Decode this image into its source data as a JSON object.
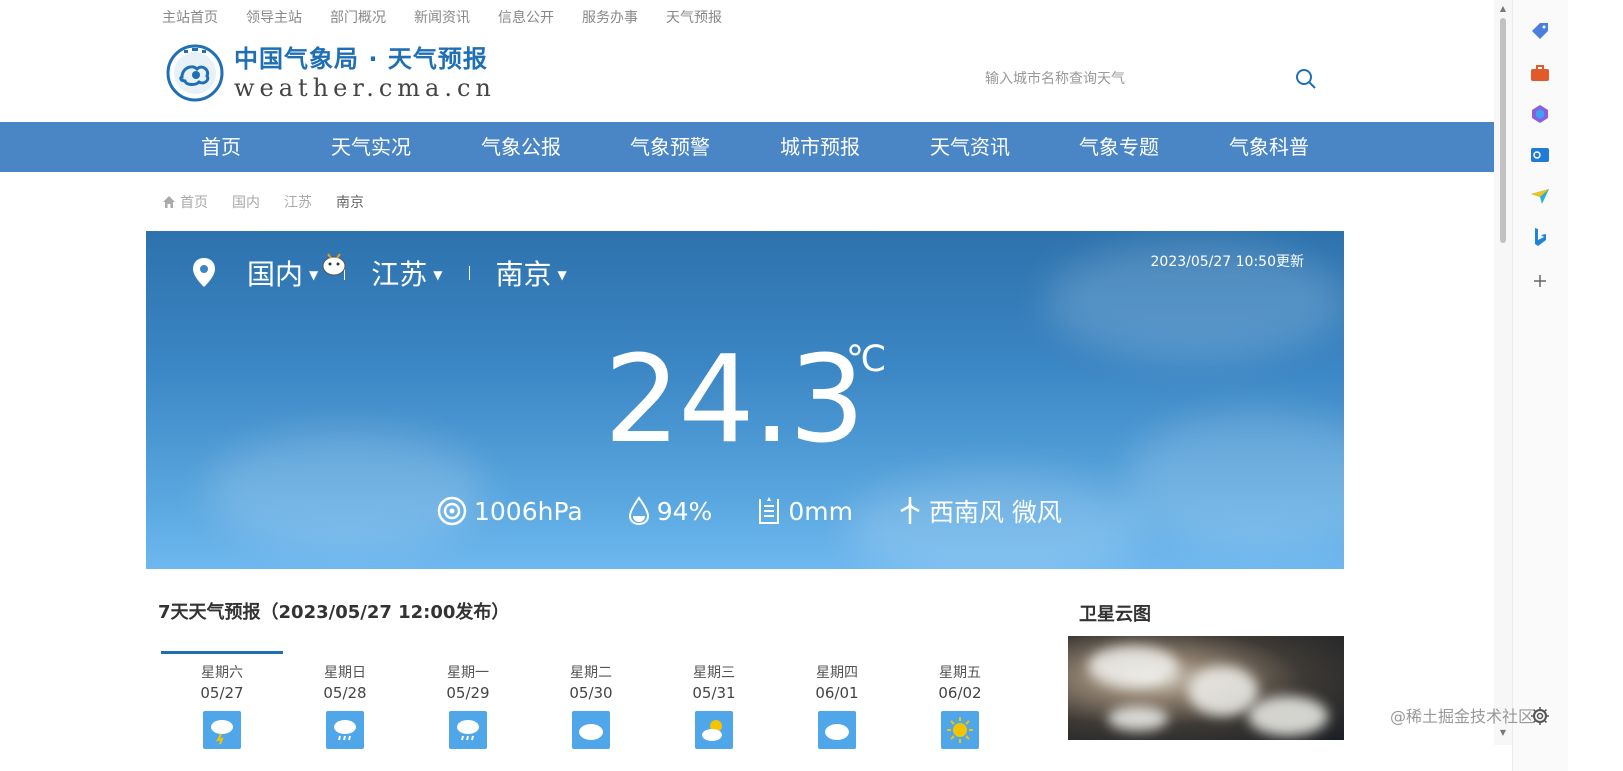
{
  "top_links": [
    "主站首页",
    "领导主站",
    "部门概况",
    "新闻资讯",
    "信息公开",
    "服务办事",
    "天气预报"
  ],
  "logo": {
    "cn": "中国气象局 · 天气预报",
    "en": "weather.cma.cn"
  },
  "search": {
    "placeholder": "输入城市名称查询天气"
  },
  "main_nav": [
    "首页",
    "天气实况",
    "气象公报",
    "气象预警",
    "城市预报",
    "天气资讯",
    "气象专题",
    "气象科普"
  ],
  "breadcrumb": [
    "首页",
    "国内",
    "江苏",
    "南京"
  ],
  "location": {
    "country": "国内",
    "province": "江苏",
    "city": "南京"
  },
  "updated": "2023/05/27 10:50更新",
  "current": {
    "temperature": "24.3",
    "unit": "℃",
    "pressure": "1006hPa",
    "humidity": "94%",
    "precipitation": "0mm",
    "wind": "西南风 微风"
  },
  "forecast": {
    "title": "7天天气预报（2023/05/27 12:00发布）",
    "days": [
      {
        "weekday": "星期六",
        "date": "05/27",
        "icon": "thunder-rain-icon"
      },
      {
        "weekday": "星期日",
        "date": "05/28",
        "icon": "rain-icon"
      },
      {
        "weekday": "星期一",
        "date": "05/29",
        "icon": "rain-icon"
      },
      {
        "weekday": "星期二",
        "date": "05/30",
        "icon": "cloudy-icon"
      },
      {
        "weekday": "星期三",
        "date": "05/31",
        "icon": "partly-sunny-icon"
      },
      {
        "weekday": "星期四",
        "date": "06/01",
        "icon": "cloudy-icon"
      },
      {
        "weekday": "星期五",
        "date": "06/02",
        "icon": "sunny-icon"
      }
    ]
  },
  "satellite": {
    "title": "卫星云图"
  },
  "watermark": "@稀土掘金技术社区",
  "colors": {
    "nav_blue": "#4a86c5",
    "hero_top": "#2d72ad",
    "hero_bottom": "#6eb8ef",
    "brand_blue": "#1f6fb5"
  }
}
